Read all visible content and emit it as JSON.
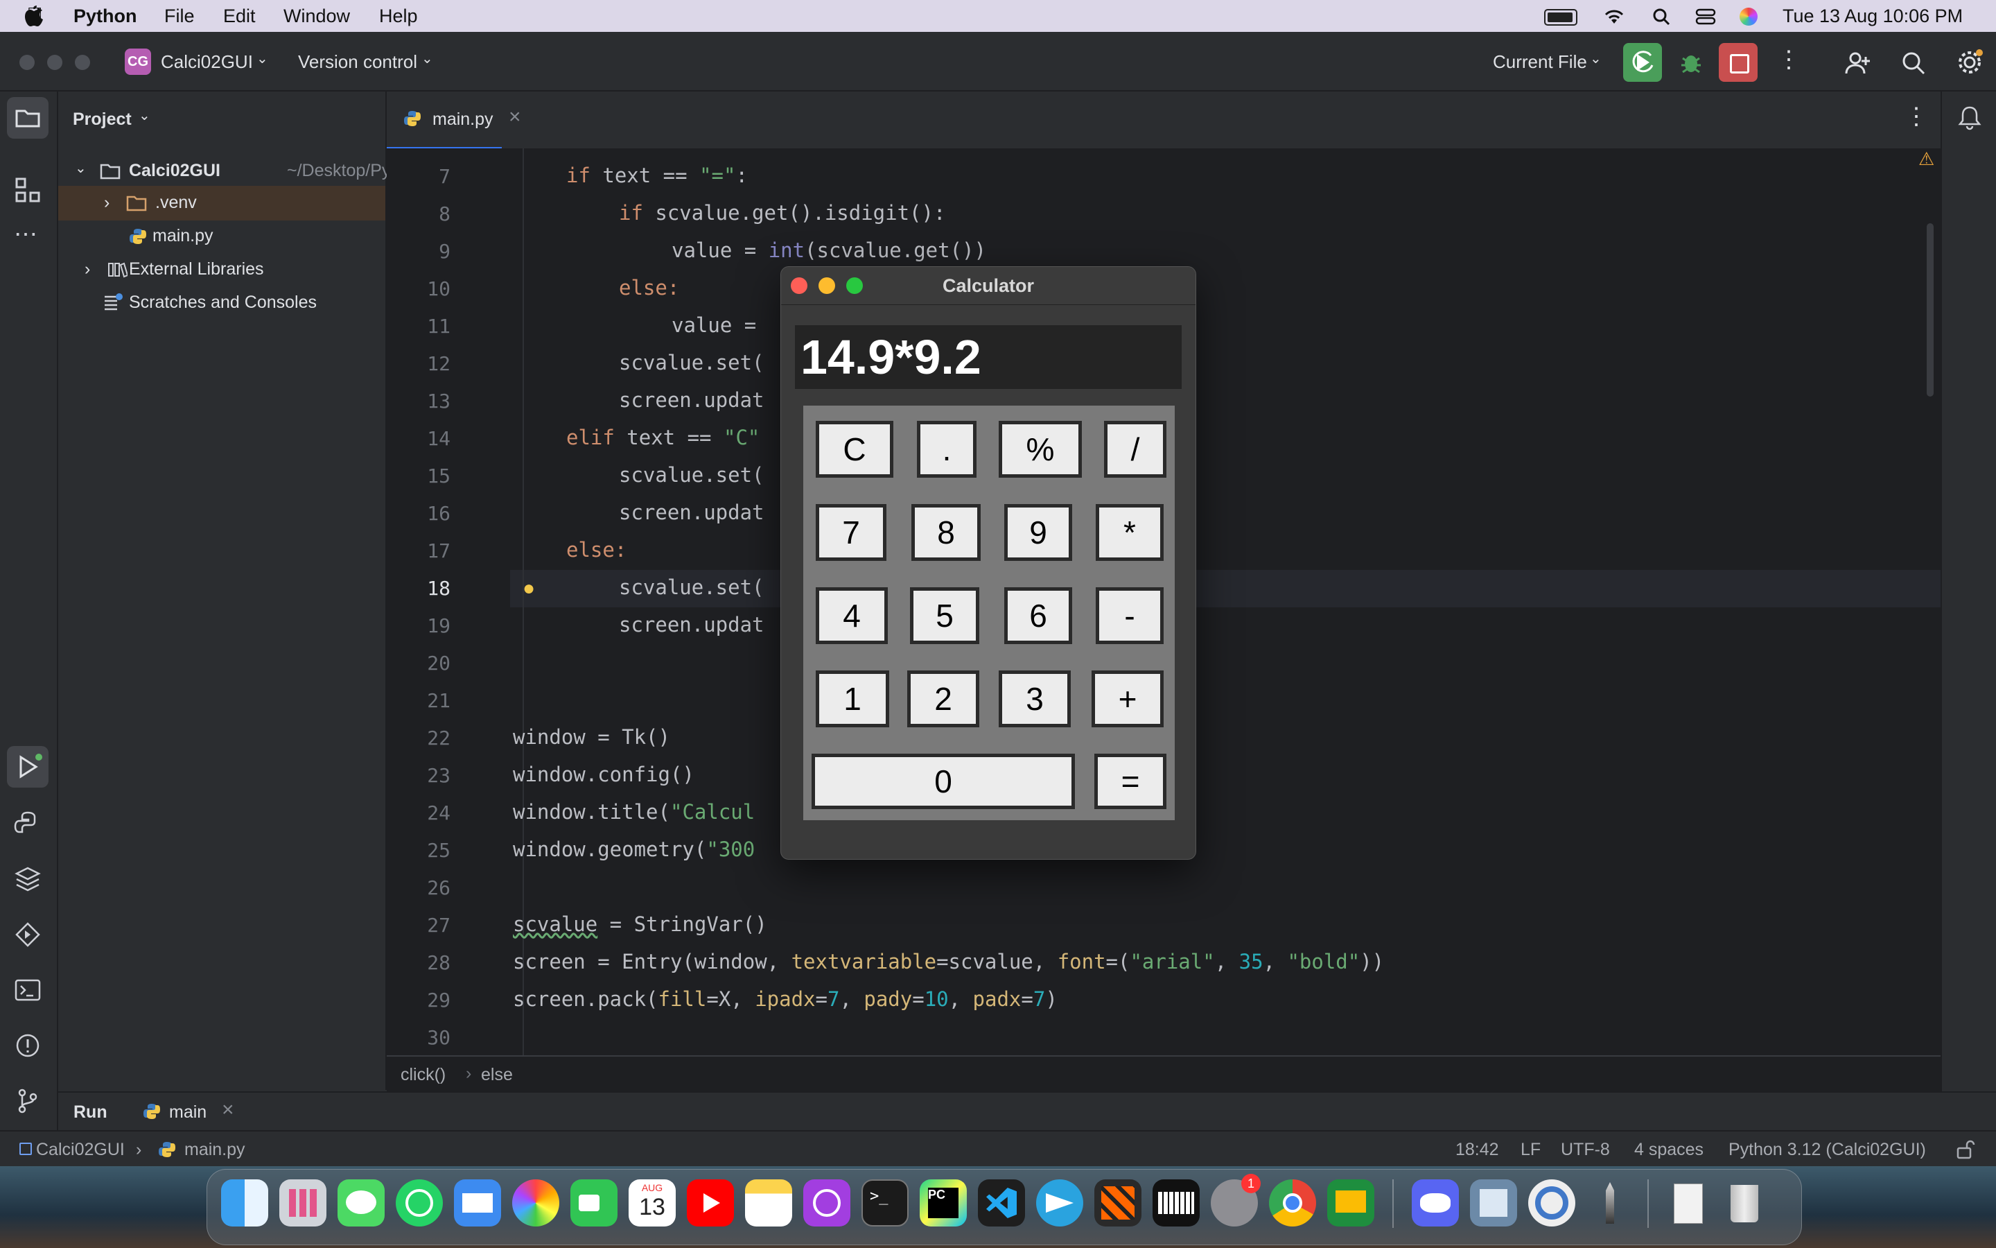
{
  "menubar": {
    "app": "Python",
    "items": [
      "File",
      "Edit",
      "Window",
      "Help"
    ],
    "datetime": "Tue 13 Aug  10:06 PM"
  },
  "titlebar": {
    "project_initials": "CG",
    "project_name": "Calci02GUI",
    "vcs": "Version control",
    "run_config": "Current File"
  },
  "project_panel": {
    "title": "Project",
    "root": "Calci02GUI",
    "root_path": "~/Desktop/Python P",
    "items": [
      ".venv",
      "main.py",
      "External Libraries",
      "Scratches and Consoles"
    ]
  },
  "editor": {
    "tab": "main.py",
    "line_numbers": [
      "7",
      "8",
      "9",
      "10",
      "11",
      "12",
      "13",
      "14",
      "15",
      "16",
      "17",
      "18",
      "19",
      "20",
      "21",
      "22",
      "23",
      "24",
      "25",
      "26",
      "27",
      "28",
      "29",
      "30"
    ],
    "lines": {
      "l7": "if text == \"=\":",
      "l8": "if scvalue.get().isdigit():",
      "l9": "value = int(scvalue.get())",
      "l10": "else:",
      "l11": "value = ",
      "l12": "scvalue.set(",
      "l13": "screen.updat",
      "l14": "elif text == \"C\"",
      "l15": "scvalue.set(",
      "l16": "screen.updat",
      "l17": "else:",
      "l18": "scvalue.set(",
      "l19": "screen.updat",
      "l22": "window = Tk()",
      "l23": "window.config()",
      "l24": "window.title(\"Calcul",
      "l25": "window.geometry(\"300",
      "l27": "scvalue = StringVar()",
      "l28": "screen = Entry(window, textvariable=scvalue, font=(\"arial\", 35, \"bold\"))",
      "l29": "screen.pack(fill=X, ipadx=7, pady=10, padx=7)"
    },
    "breadcrumb": [
      "click()",
      "else"
    ]
  },
  "run_panel": {
    "label": "Run",
    "tab": "main"
  },
  "statusbar": {
    "project": "Calci02GUI",
    "file": "main.py",
    "position": "18:42",
    "line_sep": "LF",
    "encoding": "UTF-8",
    "indent": "4 spaces",
    "interpreter": "Python 3.12 (Calci02GUI)"
  },
  "calculator": {
    "title": "Calculator",
    "display": "14.9*9.2",
    "keys": [
      [
        "C",
        ".",
        "%",
        "/"
      ],
      [
        "7",
        "8",
        "9",
        "*"
      ],
      [
        "4",
        "5",
        "6",
        "-"
      ],
      [
        "1",
        "2",
        "3",
        "+"
      ],
      [
        "0",
        "="
      ]
    ]
  },
  "dock": {
    "calendar_month": "AUG",
    "calendar_day": "13",
    "settings_badge": "1",
    "icons": [
      "finder-icon",
      "launchpad-icon",
      "messages-icon",
      "whatsapp-icon",
      "mail-icon",
      "photos-icon",
      "facetime-icon",
      "calendar-icon",
      "youtube-icon",
      "notes-icon",
      "podcasts-icon",
      "terminal-icon",
      "pycharm-icon",
      "vscode-icon",
      "telegram-icon",
      "app-icon",
      "piano-icon",
      "settings-icon",
      "chrome-icon",
      "classroom-icon",
      "discord-icon",
      "preview-icon",
      "quicktime-icon",
      "pen-icon",
      "documents-icon",
      "trash-icon"
    ]
  },
  "colors": {
    "keyword": "#cf8e6d",
    "string": "#6aab73",
    "number": "#2aacb8",
    "param": "#d5b778",
    "builtin": "#8888c6",
    "run_button": "#4a9e5a",
    "stop_button": "#c94f4f"
  }
}
